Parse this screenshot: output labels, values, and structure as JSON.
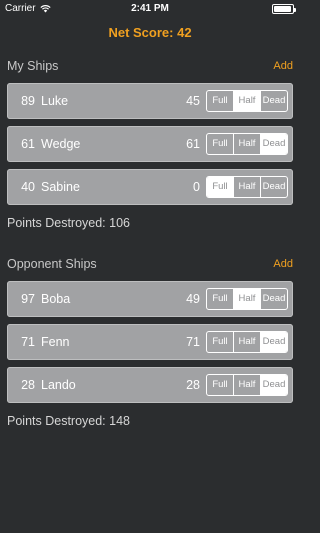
{
  "status_bar": {
    "carrier": "Carrier",
    "time": "2:41 PM"
  },
  "header": {
    "net_score": "Net Score: 42"
  },
  "accent_color": "#f0a020",
  "my_ships": {
    "title": "My Ships",
    "add_label": "Add",
    "ships": [
      {
        "points": "89",
        "name": "Luke",
        "remaining": "45",
        "state": "Half"
      },
      {
        "points": "61",
        "name": "Wedge",
        "remaining": "61",
        "state": "Dead"
      },
      {
        "points": "40",
        "name": "Sabine",
        "remaining": "0",
        "state": "Full"
      }
    ],
    "points_destroyed": "Points Destroyed: 106"
  },
  "opponent_ships": {
    "title": "Opponent Ships",
    "add_label": "Add",
    "ships": [
      {
        "points": "97",
        "name": "Boba",
        "remaining": "49",
        "state": "Half"
      },
      {
        "points": "71",
        "name": "Fenn",
        "remaining": "71",
        "state": "Dead"
      },
      {
        "points": "28",
        "name": "Lando",
        "remaining": "28",
        "state": "Dead"
      }
    ],
    "points_destroyed": "Points Destroyed: 148"
  },
  "segment_options": [
    "Full",
    "Half",
    "Dead"
  ]
}
